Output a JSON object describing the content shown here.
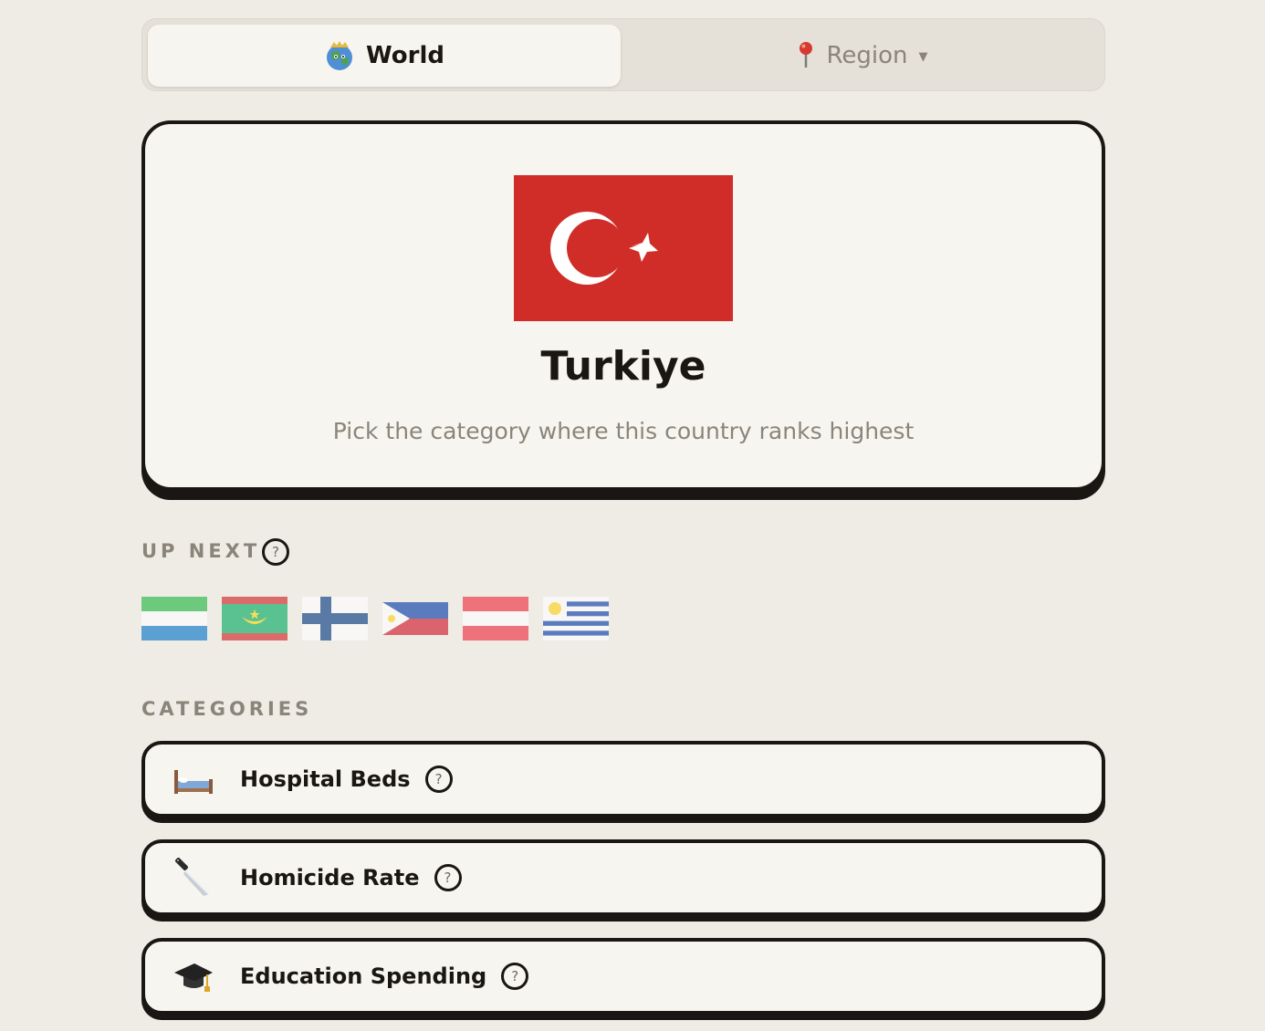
{
  "mode_toggle": {
    "world_label": "World",
    "region_label": "Region",
    "active": "World"
  },
  "current_country": {
    "name": "Turkiye",
    "instruction": "Pick the category where this country ranks highest"
  },
  "up_next": {
    "label": "UP NEXT",
    "help": "?",
    "flags": [
      "sierra-leone",
      "mauritania",
      "finland",
      "philippines",
      "austria",
      "uruguay"
    ]
  },
  "categories": {
    "label": "CATEGORIES",
    "items": [
      {
        "label": "Hospital Beds",
        "icon": "bed-icon",
        "help": "?"
      },
      {
        "label": "Homicide Rate",
        "icon": "knife-icon",
        "help": "?"
      },
      {
        "label": "Education Spending",
        "icon": "graduation-cap-icon",
        "help": "?"
      }
    ]
  },
  "colors": {
    "background": "#efece6",
    "card": "#f7f5f0",
    "ink": "#1a1613",
    "muted": "#8b8579",
    "turkey_red": "#d12d28"
  }
}
